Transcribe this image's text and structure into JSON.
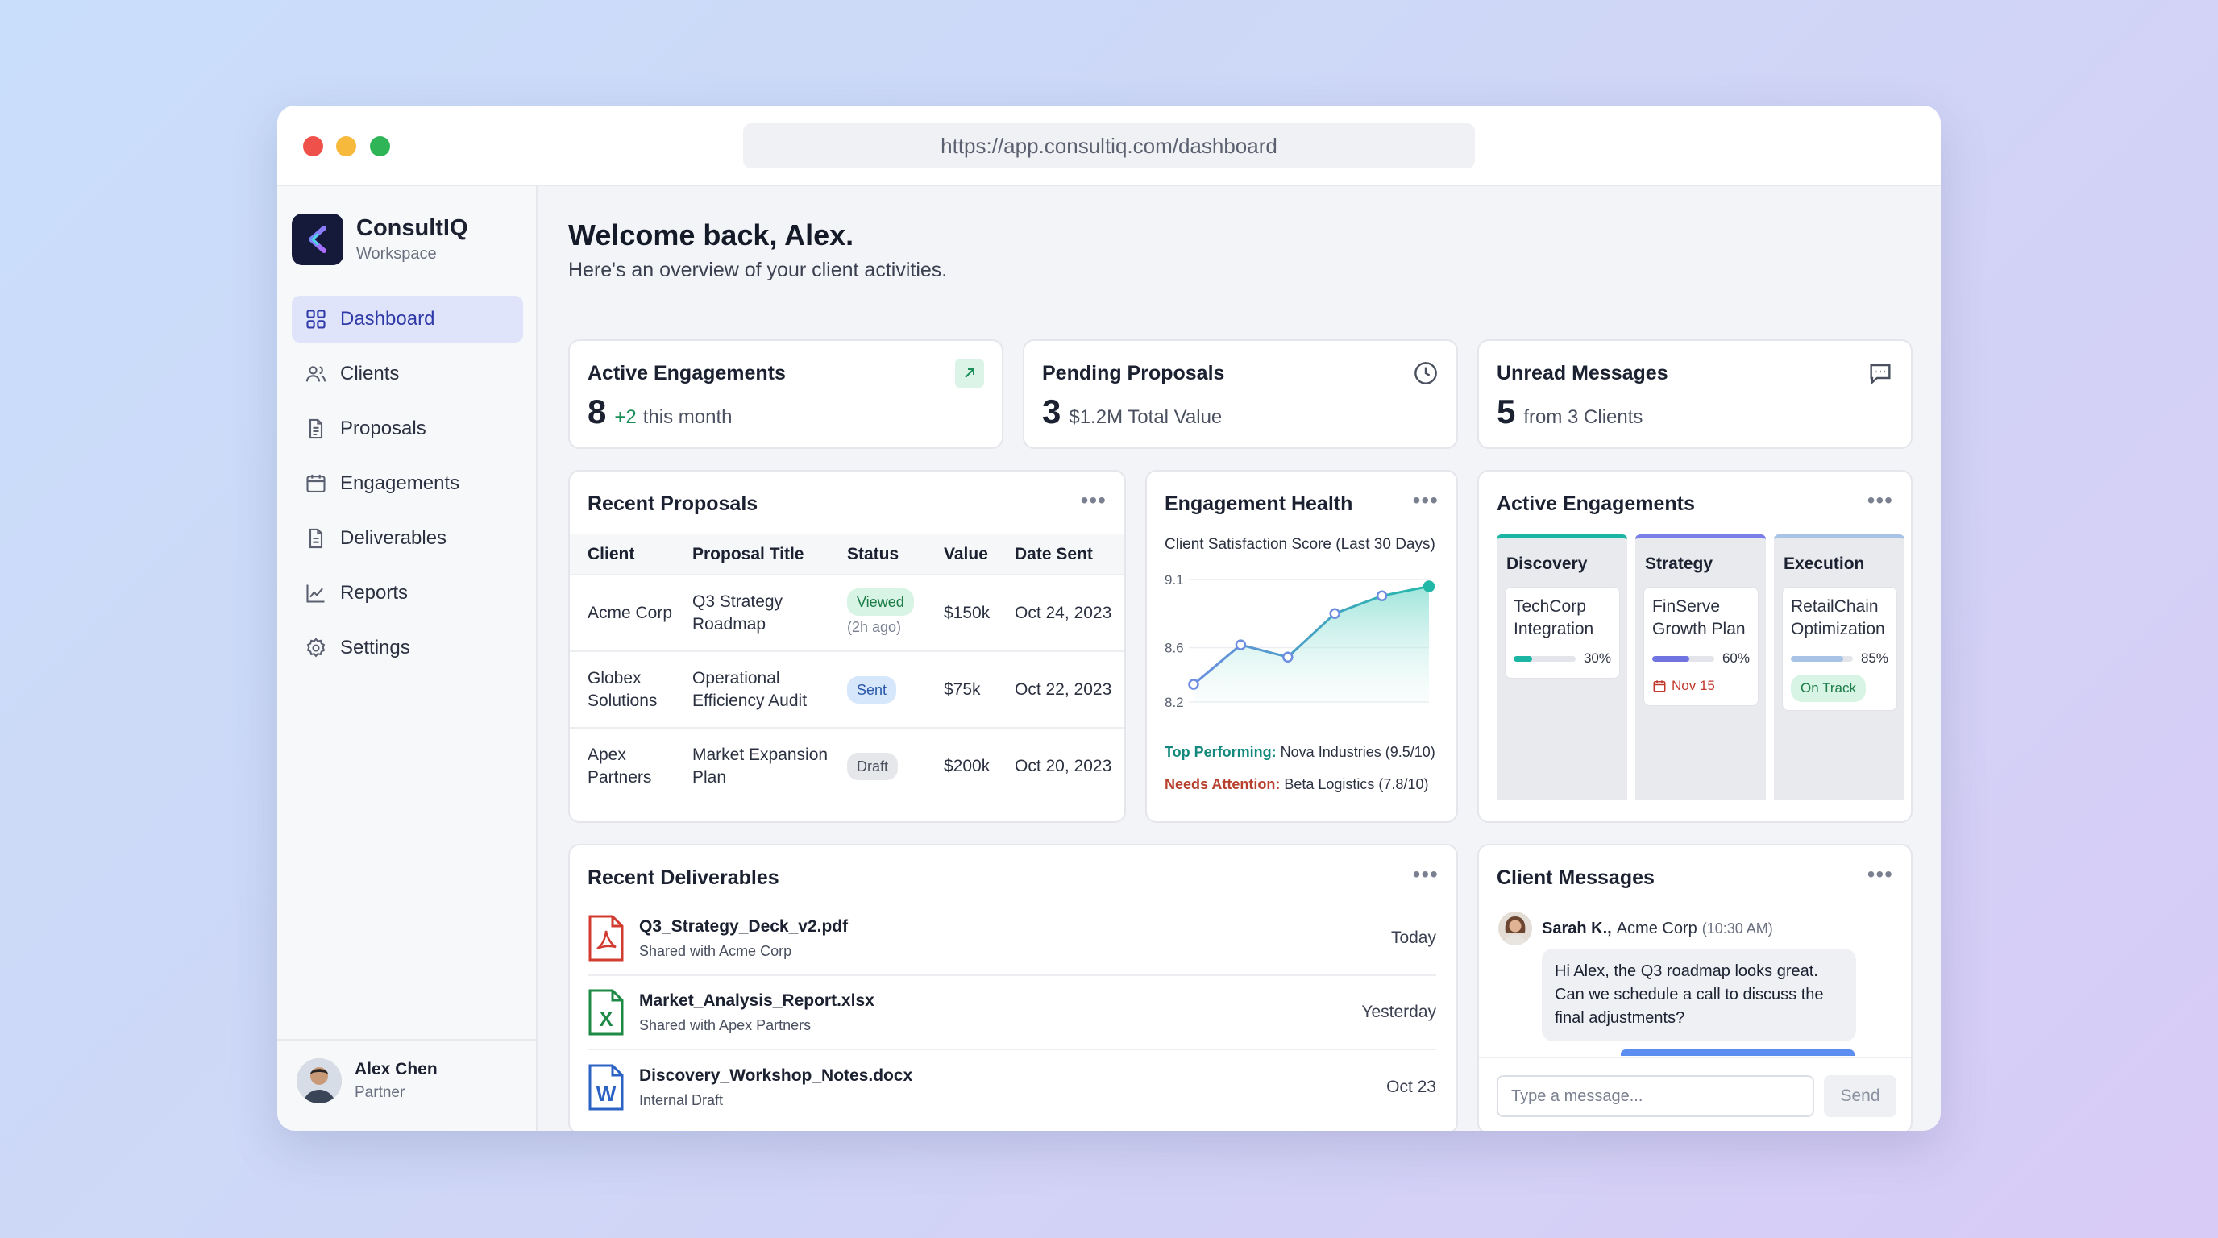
{
  "browser": {
    "url": "https://app.consultiq.com/dashboard"
  },
  "brand": {
    "name": "ConsultIQ",
    "subtitle": "Workspace"
  },
  "nav": [
    {
      "label": "Dashboard",
      "icon": "grid-icon",
      "active": true
    },
    {
      "label": "Clients",
      "icon": "users-icon"
    },
    {
      "label": "Proposals",
      "icon": "document-icon"
    },
    {
      "label": "Engagements",
      "icon": "calendar-icon"
    },
    {
      "label": "Deliverables",
      "icon": "file-icon"
    },
    {
      "label": "Reports",
      "icon": "chart-icon"
    },
    {
      "label": "Settings",
      "icon": "gear-icon"
    }
  ],
  "user": {
    "name": "Alex Chen",
    "role": "Partner"
  },
  "header": {
    "welcome": "Welcome back, Alex.",
    "subtitle": "Here's an overview of your client activities."
  },
  "stats": [
    {
      "title": "Active Engagements",
      "value": "8",
      "detail_accent": "+2",
      "detail": "this month",
      "icon": "trend-up-icon"
    },
    {
      "title": "Pending Proposals",
      "value": "3",
      "detail": "$1.2M Total Value",
      "icon": "clock-icon"
    },
    {
      "title": "Unread Messages",
      "value": "5",
      "detail": "from 3 Clients",
      "icon": "message-icon"
    }
  ],
  "proposals": {
    "title": "Recent Proposals",
    "columns": [
      "Client",
      "Proposal Title",
      "Status",
      "Value",
      "Date Sent"
    ],
    "rows": [
      {
        "client": "Acme Corp",
        "title": "Q3 Strategy Roadmap",
        "status": "Viewed",
        "status_note": "(2h ago)",
        "value": "$150k",
        "date": "Oct 24, 2023"
      },
      {
        "client": "Globex Solutions",
        "title": "Operational Efficiency Audit",
        "status": "Sent",
        "status_note": "",
        "value": "$75k",
        "date": "Oct 22, 2023"
      },
      {
        "client": "Apex Partners",
        "title": "Market Expansion Plan",
        "status": "Draft",
        "status_note": "",
        "value": "$200k",
        "date": "Oct 20, 2023"
      }
    ]
  },
  "health": {
    "title": "Engagement Health",
    "subtitle": "Client Satisfaction Score (Last 30 Days)",
    "top_label": "Top Performing:",
    "top_value": "Nova Industries (9.5/10)",
    "attention_label": "Needs Attention:",
    "attention_value": "Beta Logistics (7.8/10)"
  },
  "chart_data": {
    "type": "area",
    "title": "Client Satisfaction Score (Last 30 Days)",
    "y_ticks": [
      "9.1",
      "8.6",
      "8.2"
    ],
    "ylim": [
      8.2,
      9.1
    ],
    "x": [
      1,
      2,
      3,
      4,
      5,
      6
    ],
    "values": [
      8.33,
      8.62,
      8.53,
      8.85,
      8.98,
      9.05
    ],
    "color": "#22b8a8"
  },
  "kanban": {
    "title": "Active Engagements",
    "columns": [
      {
        "name": "Discovery",
        "color": "#1bb5a3",
        "card_title": "TechCorp Integration",
        "progress": "30%",
        "progress_value": 0.3,
        "bar_color": "#1bb5a3",
        "tag": ""
      },
      {
        "name": "Strategy",
        "color": "#7a7ee8",
        "card_title": "FinServe Growth Plan",
        "progress": "60%",
        "progress_value": 0.6,
        "bar_color": "#6f74e0",
        "tag": "Nov 15"
      },
      {
        "name": "Execution",
        "color": "#a9c3e6",
        "card_title": "RetailChain Optimization",
        "progress": "85%",
        "progress_value": 0.85,
        "bar_color": "#a9c3e6",
        "tag": "On Track"
      }
    ]
  },
  "deliverables": {
    "title": "Recent Deliverables",
    "items": [
      {
        "name": "Q3_Strategy_Deck_v2.pdf",
        "note": "Shared with Acme Corp",
        "date": "Today",
        "icon": "pdf-icon"
      },
      {
        "name": "Market_Analysis_Report.xlsx",
        "note": "Shared with Apex Partners",
        "date": "Yesterday",
        "icon": "excel-icon"
      },
      {
        "name": "Discovery_Workshop_Notes.docx",
        "note": "Internal Draft",
        "date": "Oct 23",
        "icon": "word-icon"
      }
    ]
  },
  "messages": {
    "title": "Client Messages",
    "sender": "Sarah K.,",
    "company": "Acme Corp",
    "time": "(10:30 AM)",
    "text": "Hi Alex, the Q3 roadmap looks great. Can we schedule a call to discuss the final adjustments?",
    "placeholder": "Type a message...",
    "send_label": "Send"
  }
}
